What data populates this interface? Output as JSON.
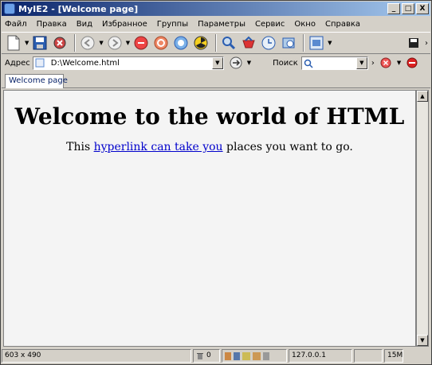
{
  "window": {
    "title": "MyIE2 - [Welcome page]"
  },
  "title_buttons": {
    "minimize": "_",
    "maximize": "□",
    "close": "X"
  },
  "menu": [
    "Файл",
    "Правка",
    "Вид",
    "Избранное",
    "Группы",
    "Параметры",
    "Сервис",
    "Окно",
    "Справка"
  ],
  "toolbar": {
    "icons": [
      "new-page-icon",
      "save-icon",
      "download-icon",
      "back-icon",
      "forward-icon",
      "stop-icon",
      "refresh-icon",
      "home-icon",
      "close-all-icon",
      "search-icon",
      "favorites-icon",
      "history-icon",
      "media-icon",
      "window-icon",
      "save-small-icon"
    ]
  },
  "address": {
    "label": "Адрес",
    "value": "D:\\Welcome.html",
    "search_label": "Поиск"
  },
  "tabs": [
    "Welcome page"
  ],
  "page": {
    "heading": "Welcome to the world of HTML",
    "text_before": "This ",
    "link_text": "hyperlink can take you",
    "text_after": " places you want to go."
  },
  "status": {
    "size": "603 x 490",
    "count": "0",
    "ip": "127.0.0.1",
    "memory": "15M"
  },
  "colors": {
    "titlebar_start": "#0a246a",
    "titlebar_end": "#a6caf0",
    "link": "#0000cc",
    "chrome": "#d4d0c8"
  }
}
